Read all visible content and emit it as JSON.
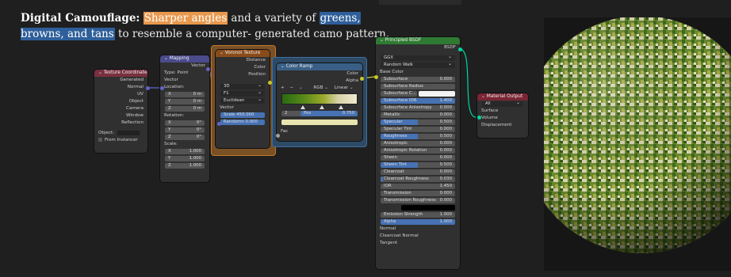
{
  "caption": {
    "lead": "Digital Camouflage:",
    "hl1": "Sharper angles",
    "mid": " and a variety of ",
    "hl2": "greens, browns, and tans",
    "tail": " to resemble a computer- generated camo pattern."
  },
  "colors": {
    "accent_orange": "#e8984d",
    "accent_blue": "#2f5f9a",
    "node_bg": "#303030",
    "frame_orange": "#c0782c",
    "frame_blue": "#3d6e9e"
  },
  "texcoord": {
    "title": "Texture Coordinate",
    "outputs": [
      "Generated",
      "Normal",
      "UV",
      "Object",
      "Camera",
      "Window",
      "Reflection"
    ],
    "object_label": "Object:",
    "from_instancer": "From Instancer"
  },
  "mapping": {
    "title": "Mapping",
    "vector_out": "Vector",
    "type_label": "Type:",
    "type_value": "Point",
    "vector_in": "Vector",
    "location": "Location:",
    "rotation": "Rotation:",
    "scale": "Scale:",
    "loc": [
      {
        "a": "X",
        "v": "0 m"
      },
      {
        "a": "Y",
        "v": "0 m"
      },
      {
        "a": "Z",
        "v": "0 m"
      }
    ],
    "rot": [
      {
        "a": "X",
        "v": "0°"
      },
      {
        "a": "Y",
        "v": "0°"
      },
      {
        "a": "Z",
        "v": "0°"
      }
    ],
    "scl": [
      {
        "a": "X",
        "v": "1.000"
      },
      {
        "a": "Y",
        "v": "1.000"
      },
      {
        "a": "Z",
        "v": "1.000"
      }
    ]
  },
  "voronoi": {
    "title": "Voronoi Texture",
    "outs": [
      "Distance",
      "Color",
      "Position"
    ],
    "dim": "3D",
    "feature": "F1",
    "metric": "Euclidean",
    "vector": "Vector",
    "scale_label": "Scale",
    "scale_value": "450.000",
    "random_label": "Randomn",
    "random_value": "0.000"
  },
  "ramp": {
    "title": "Color Ramp",
    "out_color": "Color",
    "out_alpha": "Alpha",
    "mode": "RGB",
    "interp": "Linear",
    "index": "2",
    "pos_label": "Pos",
    "pos_value": "0.750",
    "fac": "Fac"
  },
  "bsdf": {
    "title": "Principled BSDF",
    "out": "BSDF",
    "dist": "GGX",
    "sss": "Random Walk",
    "base_color": "Base Color",
    "fields": [
      {
        "label": "Subsurface",
        "value": "0.000",
        "fill": 0
      },
      {
        "label": "Subsurface Radius",
        "value": "",
        "fill": 0
      },
      {
        "label": "Subsurface C...",
        "value": "",
        "fill": 0
      },
      {
        "label": "Subsurface IOR",
        "value": "1.400",
        "fill": 1
      },
      {
        "label": "Subsurface Anisotropy",
        "value": "0.000",
        "fill": 0
      },
      {
        "label": "Metallic",
        "value": "0.000",
        "fill": 0
      },
      {
        "label": "Specular",
        "value": "0.500",
        "fill": 0.5
      },
      {
        "label": "Specular Tint",
        "value": "0.000",
        "fill": 0
      },
      {
        "label": "Roughness",
        "value": "0.500",
        "fill": 0.5
      },
      {
        "label": "Anisotropic",
        "value": "0.000",
        "fill": 0
      },
      {
        "label": "Anisotropic Rotation",
        "value": "0.000",
        "fill": 0
      },
      {
        "label": "Sheen",
        "value": "0.000",
        "fill": 0
      },
      {
        "label": "Sheen Tint",
        "value": "0.500",
        "fill": 0.5
      },
      {
        "label": "Clearcoat",
        "value": "0.000",
        "fill": 0
      },
      {
        "label": "Clearcoat Roughness",
        "value": "0.030",
        "fill": 0.03
      },
      {
        "label": "IOR",
        "value": "1.450",
        "fill": 0
      },
      {
        "label": "Transmission",
        "value": "0.000",
        "fill": 0
      },
      {
        "label": "Transmission Roughness",
        "value": "0.000",
        "fill": 0
      },
      {
        "label": "Emission",
        "value": "",
        "fill": 0
      },
      {
        "label": "Emission Strength",
        "value": "1.000",
        "fill": 0
      },
      {
        "label": "Alpha",
        "value": "1.000",
        "fill": 1
      }
    ],
    "tail": [
      "Normal",
      "Clearcoat Normal",
      "Tangent"
    ]
  },
  "output": {
    "title": "Material Output",
    "target": "All",
    "inputs": [
      "Surface",
      "Volume",
      "Displacement"
    ]
  }
}
